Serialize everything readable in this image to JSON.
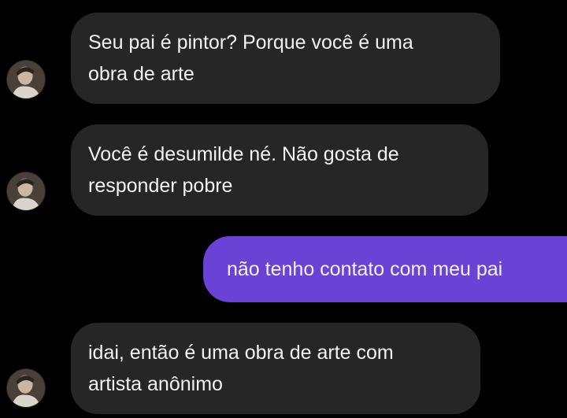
{
  "conversation": {
    "messages": [
      {
        "direction": "incoming",
        "lines": [
          "Seu pai é pintor? Porque você é uma",
          "obra de arte"
        ]
      },
      {
        "direction": "incoming",
        "lines": [
          "Você é desumilde né. Não gosta de",
          "responder pobre"
        ]
      },
      {
        "direction": "outgoing",
        "lines": [
          "não tenho contato com meu pai"
        ]
      },
      {
        "direction": "incoming",
        "lines": [
          "idai, então é uma obra de arte com",
          "artista anônimo"
        ]
      }
    ]
  },
  "colors": {
    "background": "#000000",
    "incoming_bubble": "#262626",
    "outgoing_bubble": "#6a42d6",
    "text": "#f2f2f2"
  }
}
